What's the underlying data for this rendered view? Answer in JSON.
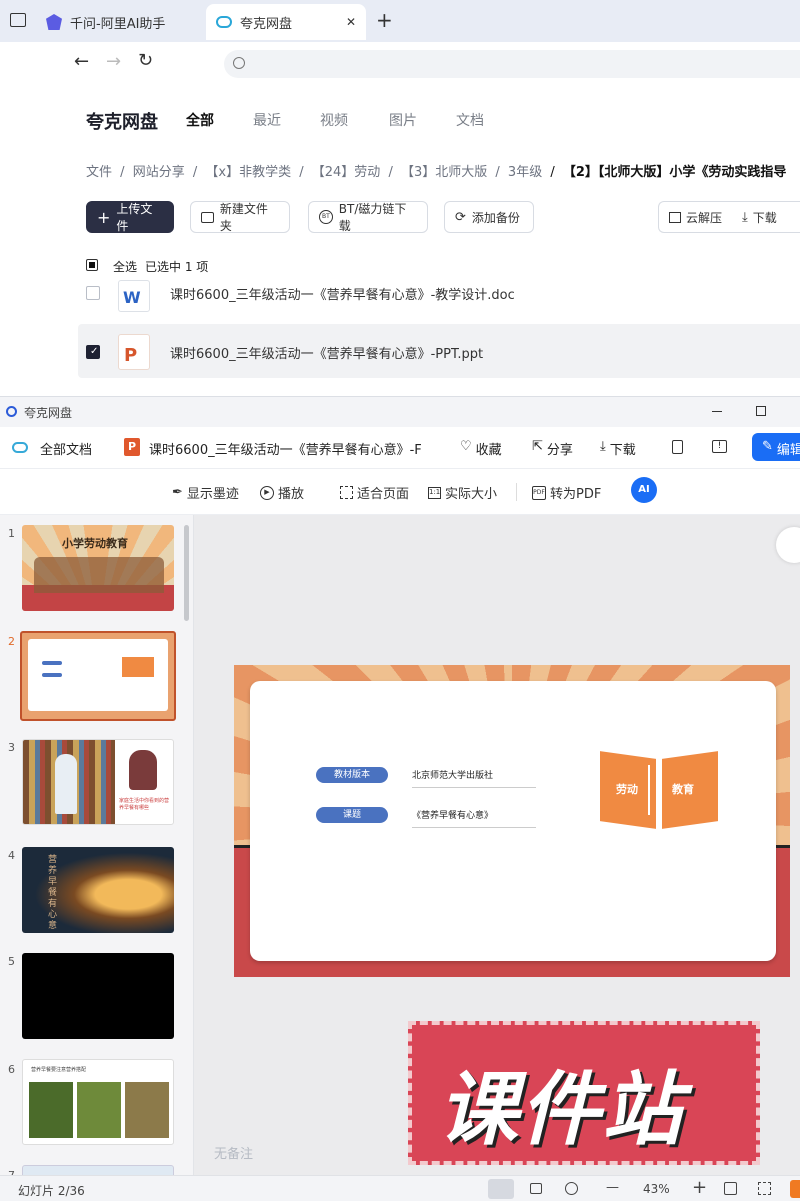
{
  "browser": {
    "tabs": [
      {
        "label": "千问-阿里AI助手"
      },
      {
        "label": "夸克网盘"
      }
    ],
    "new_tab": "+",
    "close": "✕"
  },
  "drive": {
    "logo": "夸克网盘",
    "nav": [
      "全部",
      "最近",
      "视频",
      "图片",
      "文档"
    ],
    "breadcrumb": [
      "文件",
      "网站分享",
      "【x】非教学类",
      "【24】劳动",
      "【3】北师大版",
      "3年级",
      "【2】【北师大版】小学《劳动实践指导"
    ],
    "breadcrumb_sep": "/",
    "buttons": {
      "upload": "上传文件",
      "new_folder": "新建文件夹",
      "bt": "BT/磁力链下载",
      "backup": "添加备份",
      "unzip": "云解压",
      "download": "下载"
    },
    "select_all": "全选",
    "selected_info": "已选中 1 项",
    "files": [
      {
        "name": "课时6600_三年级活动一《营养早餐有心意》-教学设计.doc",
        "icon": "W",
        "checked": false
      },
      {
        "name": "课时6600_三年级活动一《营养早餐有心意》-PPT.ppt",
        "icon": "P",
        "checked": true
      }
    ]
  },
  "viewer": {
    "window_title": "夸克网盘",
    "all_docs": "全部文档",
    "doc_title": "课时6600_三年级活动一《营养早餐有心意》-F",
    "doc_badge": "P",
    "actions": {
      "fav": "收藏",
      "share": "分享",
      "download": "下载",
      "edit": "编辑"
    },
    "tools": {
      "ink": "显示墨迹",
      "play": "播放",
      "fit": "适合页面",
      "actual": "实际大小",
      "pdf": "转为PDF",
      "ai": "AI"
    },
    "thumbs": [
      {
        "num": "1",
        "title": "小学劳动教育"
      },
      {
        "num": "2"
      },
      {
        "num": "3",
        "caption": "家庭生活中你看到的营养早餐有哪些"
      },
      {
        "num": "4",
        "caption": "营养早餐有心意"
      },
      {
        "num": "5"
      },
      {
        "num": "6",
        "caption": "营养早餐要注意营养搭配"
      },
      {
        "num": "7"
      }
    ],
    "slide": {
      "label1": "教材版本",
      "value1": "北京师范大学出版社",
      "label2": "课题",
      "value2": "《营养早餐有心意》",
      "book_left": "劳动",
      "book_right": "教育"
    },
    "watermark": "课件站",
    "notes_placeholder": "无备注",
    "status": {
      "slide_count": "幻灯片 2/36",
      "zoom": "43%",
      "minus": "—",
      "plus": "+"
    }
  },
  "colors": {
    "accent_blue": "#1a6df5",
    "upload_btn": "#2b2f44",
    "slide_orange": "#e79563",
    "slide_red": "#c9494a",
    "label_blue": "#4a72c0",
    "book_orange": "#f08a42",
    "watermark_red": "#d94556"
  }
}
